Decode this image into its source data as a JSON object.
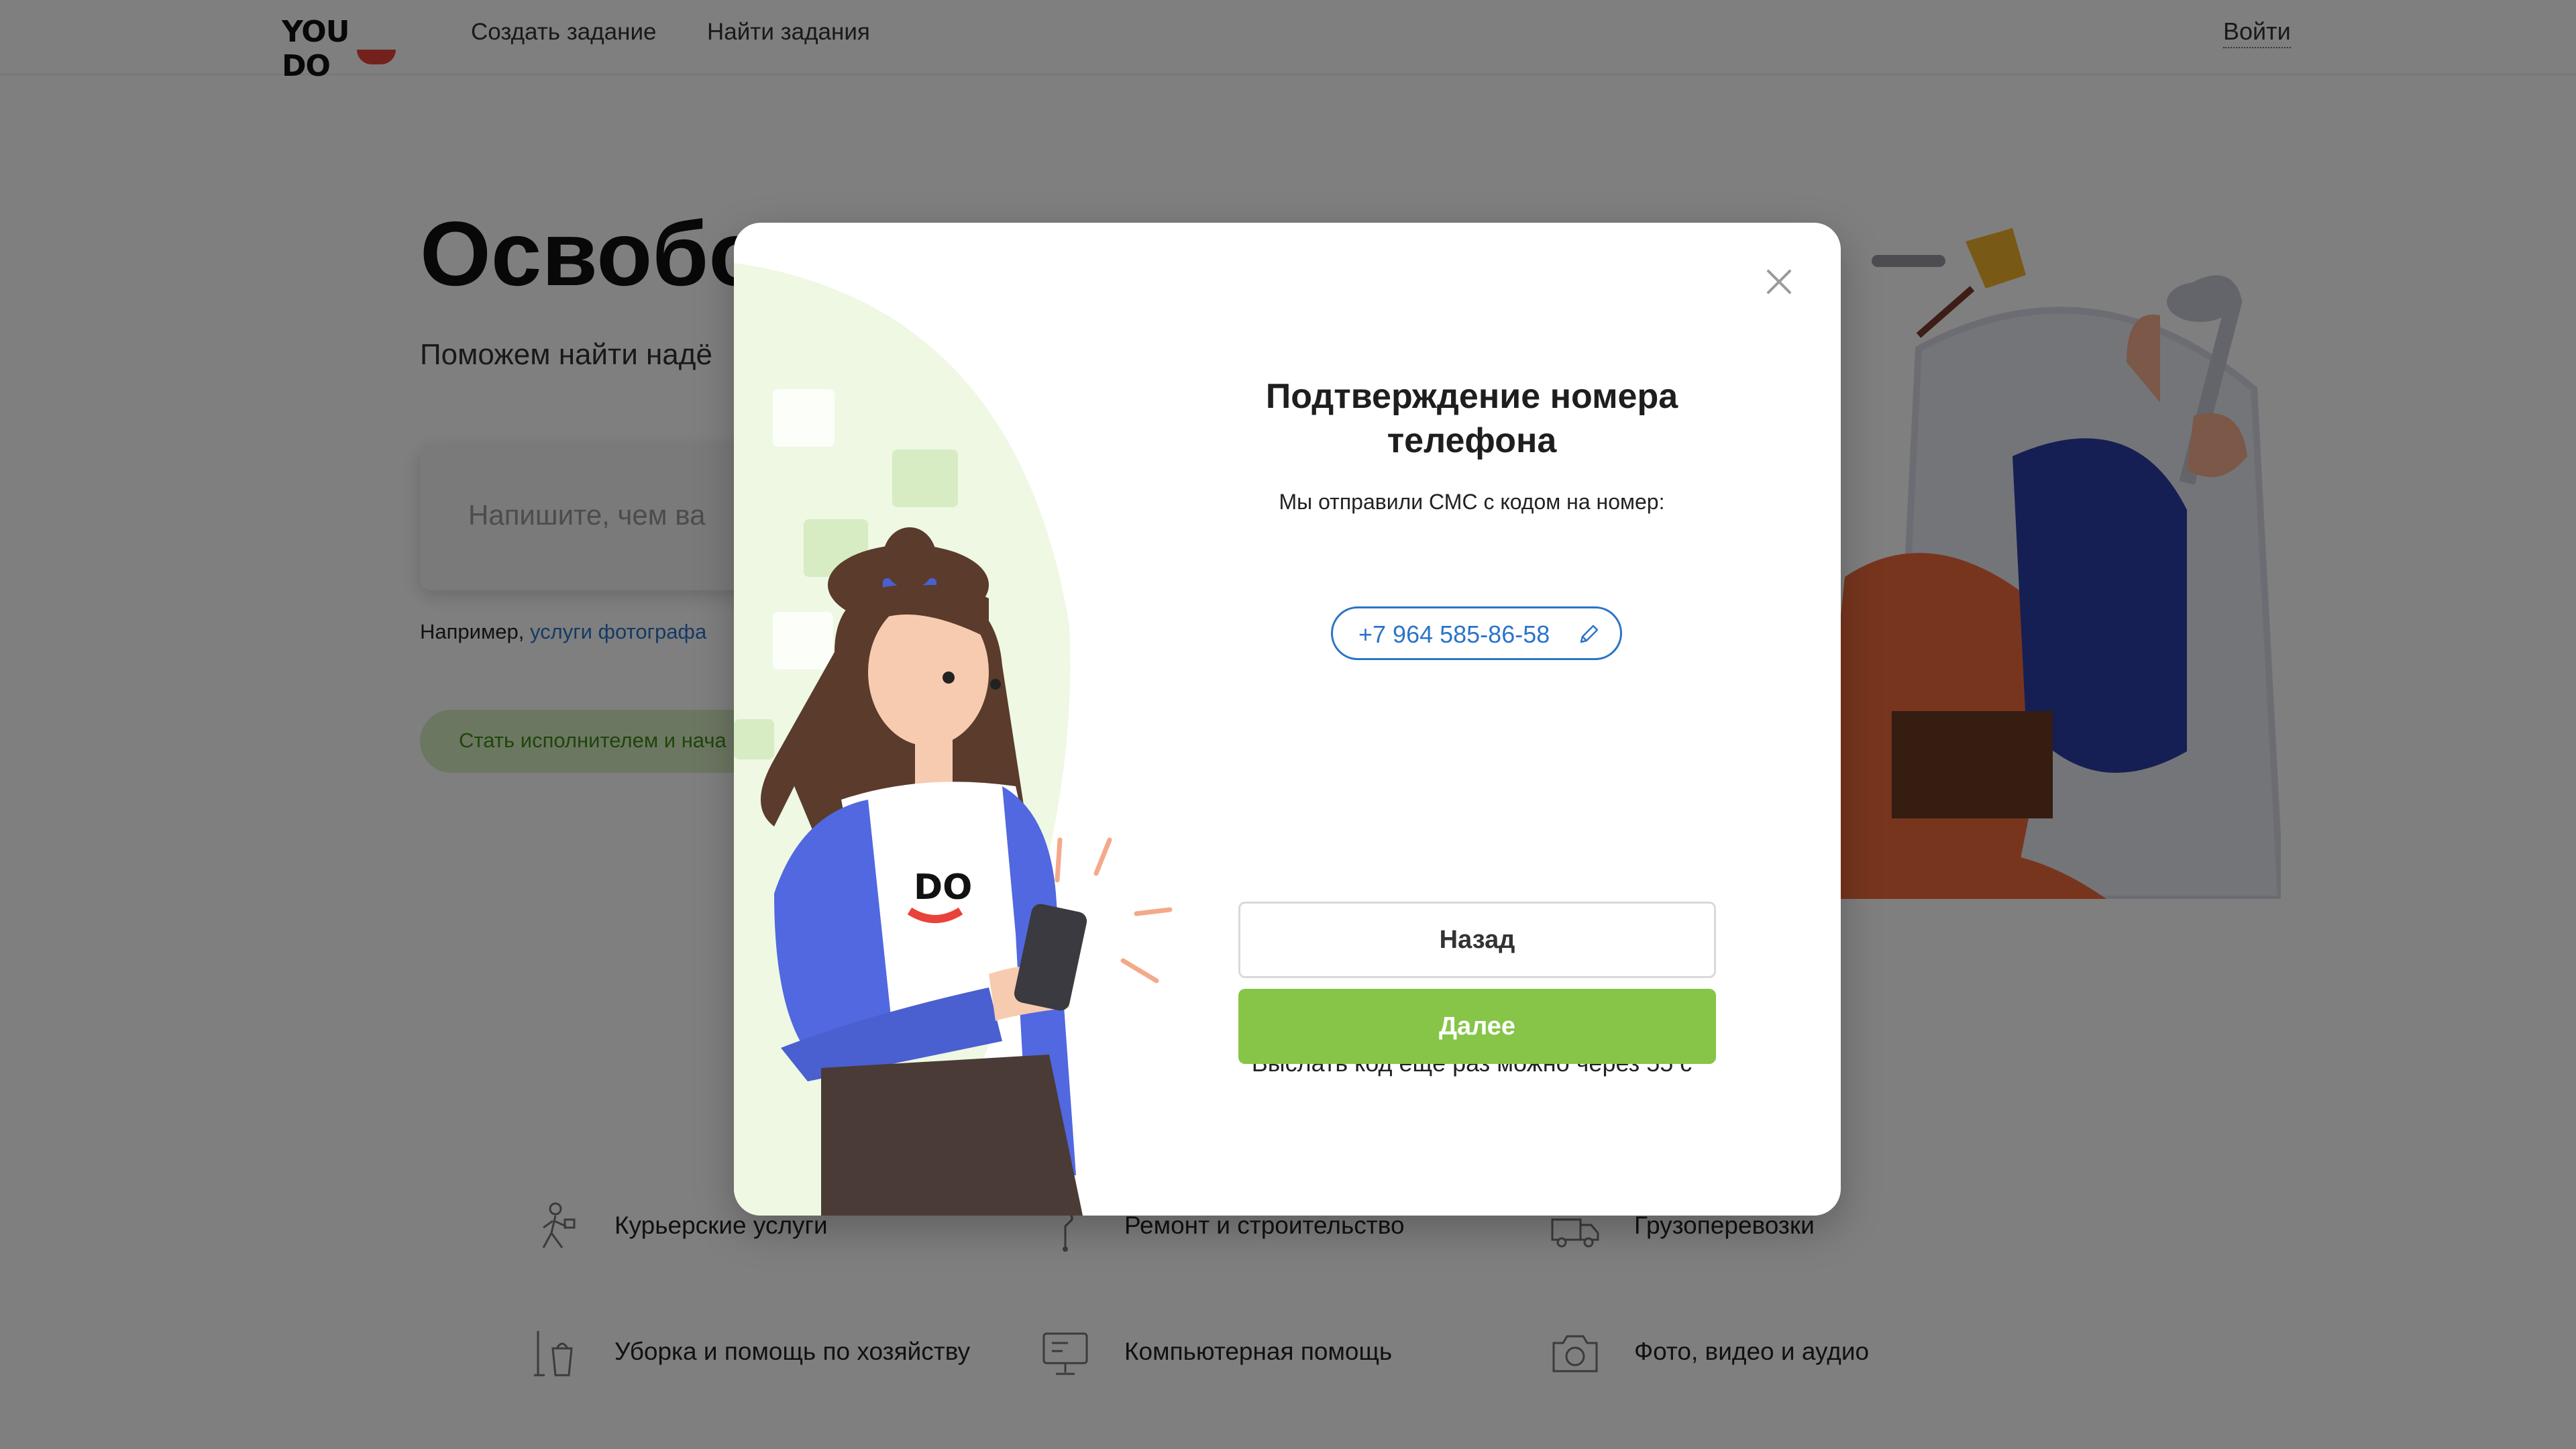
{
  "header": {
    "logo": "YOU DO",
    "nav": [
      "Создать задание",
      "Найти задания"
    ],
    "login": "Войти"
  },
  "hero": {
    "title": "Освобо",
    "subtitle": "Поможем найти надё",
    "search_placeholder": "Напишите, чем ва",
    "example_prefix": "Например,",
    "example_link": "услуги фотографа",
    "cta": "Стать исполнителем и нача"
  },
  "categories": [
    {
      "label": "Курьерские услуги",
      "icon": "courier-icon"
    },
    {
      "label": "Ремонт и строительство",
      "icon": "repair-icon"
    },
    {
      "label": "Грузоперевозки",
      "icon": "truck-icon"
    },
    {
      "label": "Уборка и помощь по хозяйству",
      "icon": "cleaning-icon"
    },
    {
      "label": "Компьютерная помощь",
      "icon": "computer-icon"
    },
    {
      "label": "Фото, видео и аудио",
      "icon": "camera-icon"
    }
  ],
  "modal": {
    "title": "Подтверждение номера телефона",
    "subtitle": "Мы отправили СМС с кодом на номер:",
    "phone": "+7 964 585-86-58",
    "code_value": "",
    "resend_text": "Выслать код ещё раз можно через 55 с",
    "back_label": "Назад",
    "next_label": "Далее",
    "illustration_badge": "DO"
  },
  "colors": {
    "accent_green": "#86c548",
    "link_blue": "#2b74c7",
    "input_underline": "#f0a32a",
    "brand_red": "#e8423a"
  }
}
